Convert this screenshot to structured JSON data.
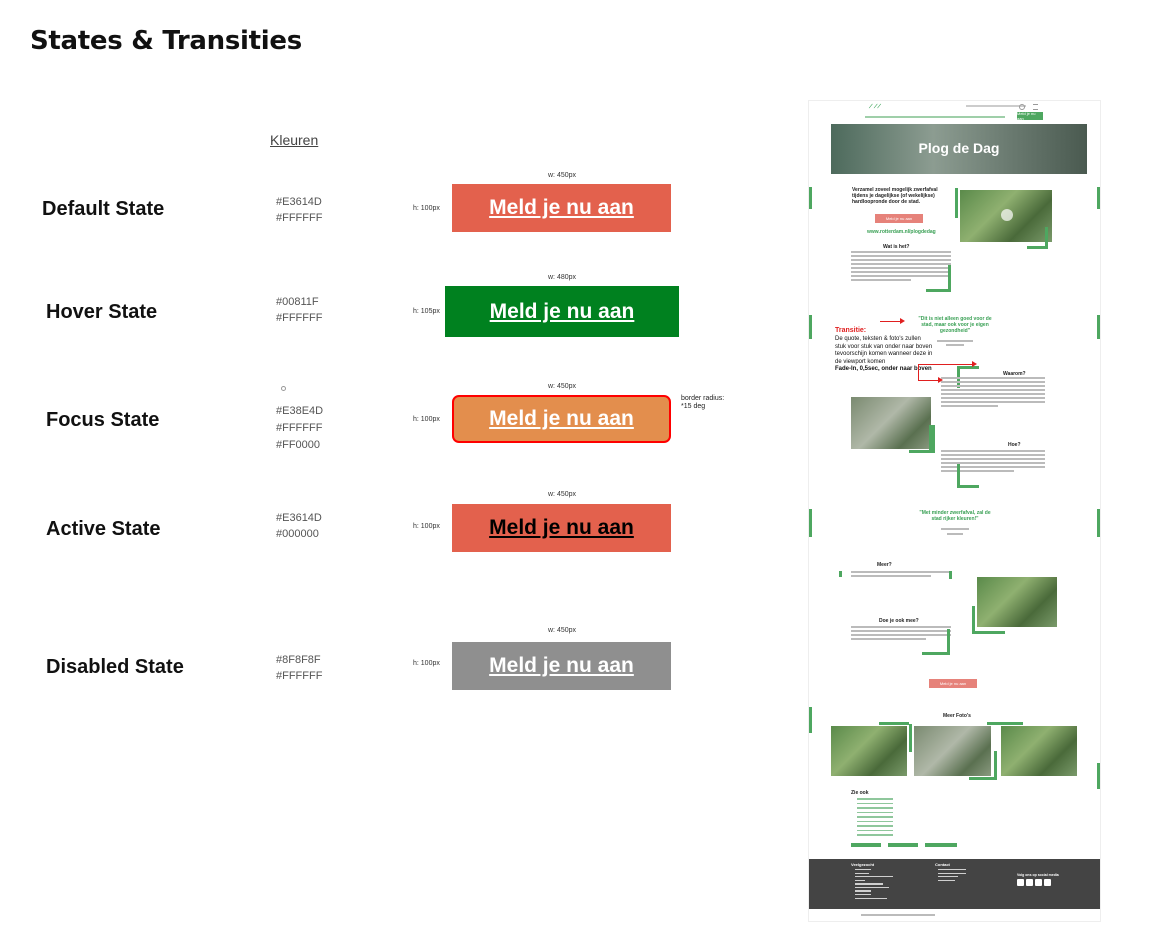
{
  "page_title": "States & Transities",
  "colors_heading": "Kleuren",
  "button_label": "Meld je nu aan",
  "states": [
    {
      "name": "Default State",
      "colors": [
        "#E3614D",
        "#FFFFFF"
      ],
      "width": "w: 450px",
      "height": "h: 100px",
      "bg": "#E3614D",
      "text": "#FFFFFF"
    },
    {
      "name": "Hover State",
      "colors": [
        "#00811F",
        "#FFFFFF"
      ],
      "width": "w: 480px",
      "height": "h: 105px",
      "bg": "#00811F",
      "text": "#FFFFFF"
    },
    {
      "name": "Focus State",
      "colors": [
        "#E38E4D",
        "#FFFFFF",
        "#FF0000"
      ],
      "width": "w: 450px",
      "height": "h: 100px",
      "bg": "#E38E4D",
      "text": "#FFFFFF",
      "border": "#FF0000"
    },
    {
      "name": "Active State",
      "colors": [
        "#E3614D",
        "#000000"
      ],
      "width": "w: 450px",
      "height": "h: 100px",
      "bg": "#E3614D",
      "text": "#000000"
    },
    {
      "name": "Disabled State",
      "colors": [
        "#8F8F8F",
        "#FFFFFF"
      ],
      "width": "w: 450px",
      "height": "h: 100px",
      "bg": "#8F8F8F",
      "text": "#FFFFFF"
    }
  ],
  "focus_note": [
    "border radius:",
    "*15 deg"
  ],
  "mockup": {
    "hero_title": "Plog de Dag",
    "intro": [
      "Verzamel zoveel mogelijk zwerfafval",
      "tijdens je dagelijkse (of wekelijkse)",
      "hardloopronde door de stad."
    ],
    "cta": "Meld je nu aan",
    "top_cta": "Meld je nu aan",
    "link": "www.rotterdam.nl/plogdedag",
    "wat_heading": "Wat is het?",
    "quote1": [
      "\"Dit is niet alleen goed voor de",
      "stad, maar ook voor je eigen",
      "gezondheid\""
    ],
    "waarom_heading": "Waarom?",
    "hoe_heading": "Hoe?",
    "quote2": [
      "\"Met minder zwerfafval, zal de",
      "stad rijker kleuren!\""
    ],
    "meer_heading": "Meer?",
    "doe_heading": "Doe je ook mee?",
    "photos_heading": "Meer Foto's",
    "zie_ook": "Zie ook",
    "footer_col1": "Veelgezocht",
    "footer_col2": "Contact",
    "footer_social": "Volg ons op social media"
  },
  "transition_title": "Transitie:",
  "transition_body": [
    "De quote, teksten & foto's zullen",
    "stuk voor stuk van onder naar boven",
    "tevoorschijn komen wanneer deze in",
    "de viewport komen"
  ],
  "transition_anim": "Fade-In, 0,5sec, onder naar boven"
}
